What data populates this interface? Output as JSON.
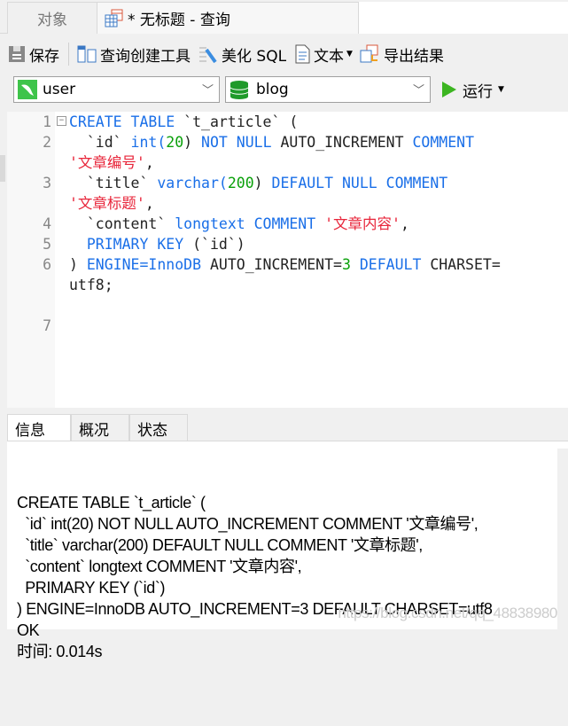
{
  "tabs": {
    "objects": "对象",
    "query": "* 无标题 - 查询"
  },
  "toolbar": {
    "save": "保存",
    "query_builder": "查询创建工具",
    "beautify": "美化 SQL",
    "text": "文本",
    "export": "导出结果"
  },
  "connection": {
    "value": "user"
  },
  "database": {
    "value": "blog"
  },
  "run": {
    "label": "运行"
  },
  "editor": {
    "rows": [
      {
        "ln": "1",
        "fold": true,
        "tokens": [
          [
            "CREATE TABLE ",
            "kw"
          ],
          [
            "`t_article` (",
            "id"
          ]
        ]
      },
      {
        "ln": "2",
        "tokens": [
          [
            "  `id` ",
            "id"
          ],
          [
            "int(",
            "kw"
          ],
          [
            "20",
            "num"
          ],
          [
            ") ",
            "id"
          ],
          [
            "NOT NULL ",
            "kw"
          ],
          [
            "AUTO_INCREMENT ",
            "id"
          ],
          [
            "COMMENT",
            "kw"
          ]
        ]
      },
      {
        "ln": "",
        "tokens": [
          [
            "'文章编号'",
            "str"
          ],
          [
            ",",
            "id"
          ]
        ]
      },
      {
        "ln": "3",
        "tokens": [
          [
            "  `title` ",
            "id"
          ],
          [
            "varchar(",
            "kw"
          ],
          [
            "200",
            "num"
          ],
          [
            ") ",
            "id"
          ],
          [
            "DEFAULT NULL COMMENT",
            "kw"
          ]
        ]
      },
      {
        "ln": "",
        "tokens": [
          [
            "'文章标题'",
            "str"
          ],
          [
            ",",
            "id"
          ]
        ]
      },
      {
        "ln": "4",
        "tokens": [
          [
            "  `content` ",
            "id"
          ],
          [
            "longtext COMMENT ",
            "kw"
          ],
          [
            "'文章内容'",
            "str"
          ],
          [
            ",",
            "id"
          ]
        ]
      },
      {
        "ln": "5",
        "tokens": [
          [
            "  PRIMARY KEY ",
            "kw"
          ],
          [
            "(`id`)",
            "id"
          ]
        ]
      },
      {
        "ln": "6",
        "tokens": [
          [
            ") ",
            "id"
          ],
          [
            "ENGINE=InnoDB ",
            "kw"
          ],
          [
            "AUTO_INCREMENT=",
            "id"
          ],
          [
            "3",
            "num"
          ],
          [
            " DEFAULT ",
            "kw"
          ],
          [
            "CHARSET=",
            "id"
          ]
        ]
      },
      {
        "ln": "",
        "tokens": [
          [
            "utf8;",
            "id"
          ]
        ]
      },
      {
        "ln": "",
        "tokens": []
      },
      {
        "ln": "7",
        "tokens": []
      }
    ]
  },
  "panel": {
    "tabs": [
      "信息",
      "概况",
      "状态"
    ],
    "message": "CREATE TABLE `t_article` (\n  `id` int(20) NOT NULL AUTO_INCREMENT COMMENT '文章编号',\n  `title` varchar(200) DEFAULT NULL COMMENT '文章标题',\n  `content` longtext COMMENT '文章内容',\n  PRIMARY KEY (`id`)\n) ENGINE=InnoDB AUTO_INCREMENT=3 DEFAULT CHARSET=utf8\nOK\n时间: 0.014s",
    "watermark": "https://blog.csdn.net/qq_48838980"
  },
  "colors": {
    "keyword": "#1a6fe8",
    "number": "#0aa00a",
    "string": "#e8253a",
    "run_green": "#3cb521"
  }
}
